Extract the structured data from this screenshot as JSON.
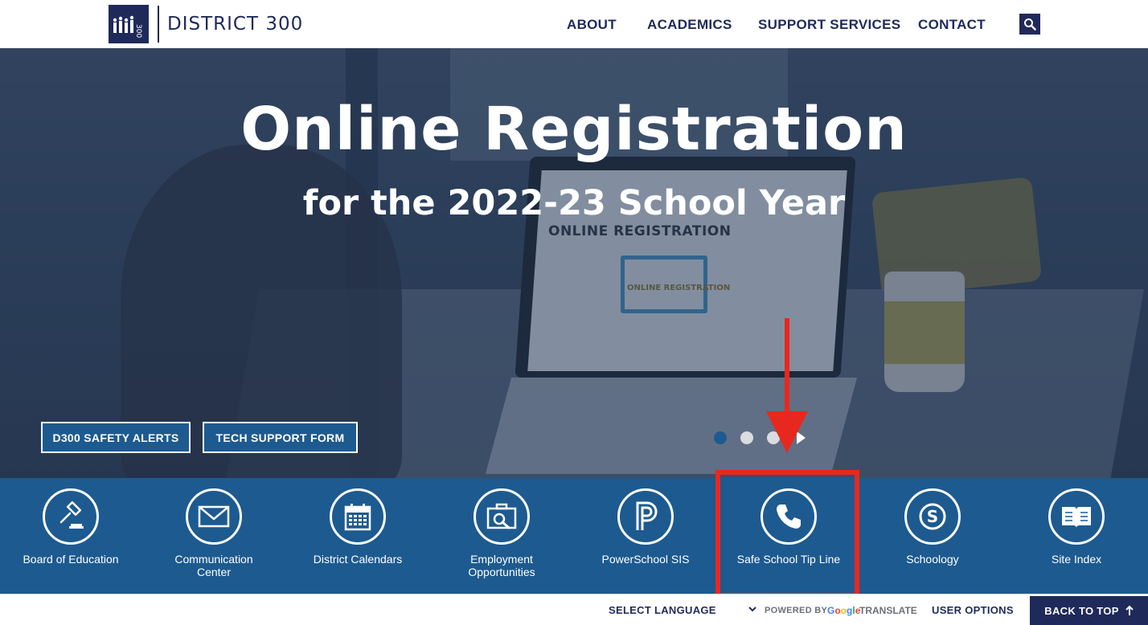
{
  "header": {
    "logo_text": "DISTRICT 300",
    "logo_mark": "300",
    "nav": [
      {
        "label": "ABOUT"
      },
      {
        "label": "ACADEMICS"
      },
      {
        "label": "SUPPORT SERVICES"
      },
      {
        "label": "CONTACT"
      }
    ],
    "search_icon": "search-icon"
  },
  "hero": {
    "title": "Online Registration",
    "subtitle": "for the 2022-23 School Year",
    "laptop_heading": "ONLINE REGISTRATION",
    "laptop_monitor_label": "ONLINE REGISTRATION",
    "buttons": [
      {
        "label": "D300 SAFETY ALERTS"
      },
      {
        "label": "TECH SUPPORT FORM"
      }
    ],
    "slides": {
      "total": 3,
      "active": 1
    }
  },
  "quick_links": [
    {
      "label": "Board of Education",
      "icon": "gavel-icon"
    },
    {
      "label": "Communication\nCenter",
      "icon": "envelope-icon"
    },
    {
      "label": "District Calendars",
      "icon": "calendar-icon"
    },
    {
      "label": "Employment\nOpportunities",
      "icon": "briefcase-icon"
    },
    {
      "label": "PowerSchool SIS",
      "icon": "powerschool-icon"
    },
    {
      "label": "Safe School Tip Line",
      "icon": "phone-icon"
    },
    {
      "label": "Schoology",
      "icon": "schoology-icon"
    },
    {
      "label": "Site Index",
      "icon": "book-icon"
    }
  ],
  "footer": {
    "select_language": "SELECT LANGUAGE",
    "powered_by": "POWERED BY",
    "google": "Google",
    "translate": "TRANSLATE",
    "user_options": "USER OPTIONS",
    "back_to_top": "BACK TO TOP"
  },
  "colors": {
    "navy": "#1f2a5a",
    "band_blue": "#1d5a8f",
    "annotation_red": "#e8281e"
  }
}
